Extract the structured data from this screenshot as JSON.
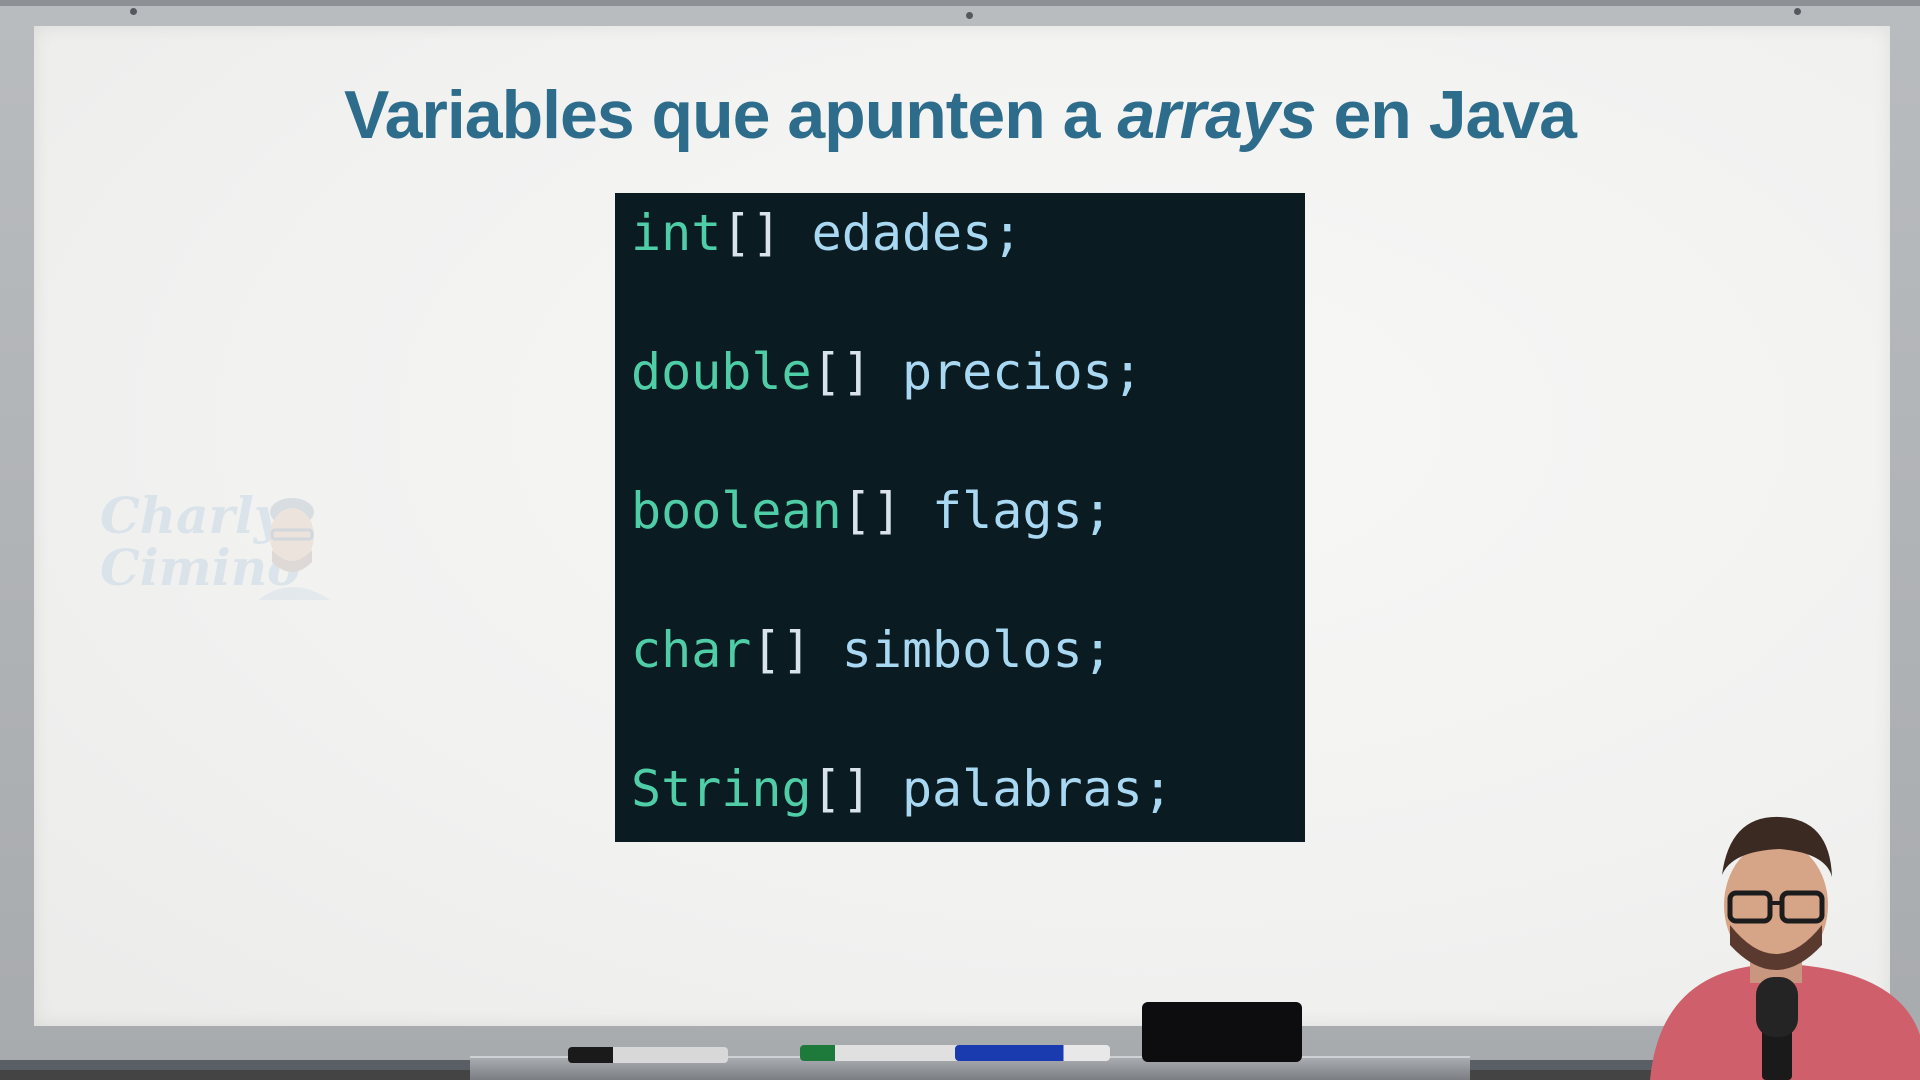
{
  "slide": {
    "title_main": "Variables que apunten a ",
    "title_italic": "arrays",
    "title_tail": " en Java"
  },
  "code": {
    "lines": [
      {
        "type": "int",
        "brackets": "[]",
        "rest": " edades;"
      },
      {
        "type": "double",
        "brackets": "[]",
        "rest": " precios;"
      },
      {
        "type": "boolean",
        "brackets": "[]",
        "rest": " flags;"
      },
      {
        "type": "char",
        "brackets": "[]",
        "rest": " simbolos;"
      },
      {
        "type": "String",
        "brackets": "[]",
        "rest": " palabras;"
      }
    ]
  },
  "watermark": {
    "line1": "Charly",
    "line2": "Cimino"
  },
  "colors": {
    "title": "#2e6c8b",
    "code_bg": "#0b1b22",
    "keyword": "#4ecda6",
    "identifier": "#a9d8f2"
  }
}
